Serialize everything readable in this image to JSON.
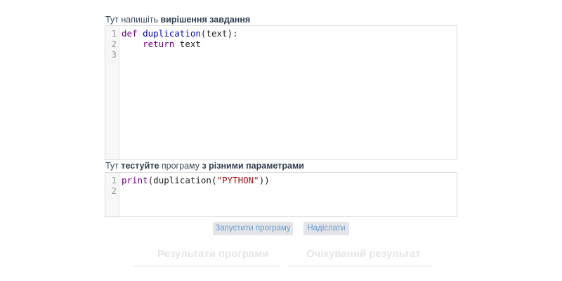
{
  "solution_label": {
    "prefix": "Тут напишіть ",
    "bold": "вирішення завдання"
  },
  "solution_editor": {
    "line_numbers": [
      "1",
      "2",
      "3"
    ],
    "line1": {
      "kw": "def",
      "sp": " ",
      "fn": "duplication",
      "rest": "(text):"
    },
    "line2": {
      "indent": "    ",
      "kw": "return",
      "rest": " text"
    }
  },
  "test_label": {
    "prefix": "Тут ",
    "bold1": "тестуйте",
    "mid": " програму ",
    "bold2": "з різними параметрами"
  },
  "test_editor": {
    "line_numbers": [
      "1",
      "2"
    ],
    "line1": {
      "fn": "print",
      "open": "(duplication(",
      "str": "\"PYTHON\"",
      "close": "))"
    }
  },
  "buttons": {
    "run_label": "Запустити програму",
    "submit_label": "Надіслати"
  },
  "results": {
    "program_results": "Результати програми",
    "expected_result": "Очікуваний результат"
  },
  "colors": {
    "keyword": "#770088",
    "function": "#0000cc",
    "string": "#aa1111",
    "button_bg": "#e3e5e8",
    "button_text": "#6a9dd0"
  }
}
